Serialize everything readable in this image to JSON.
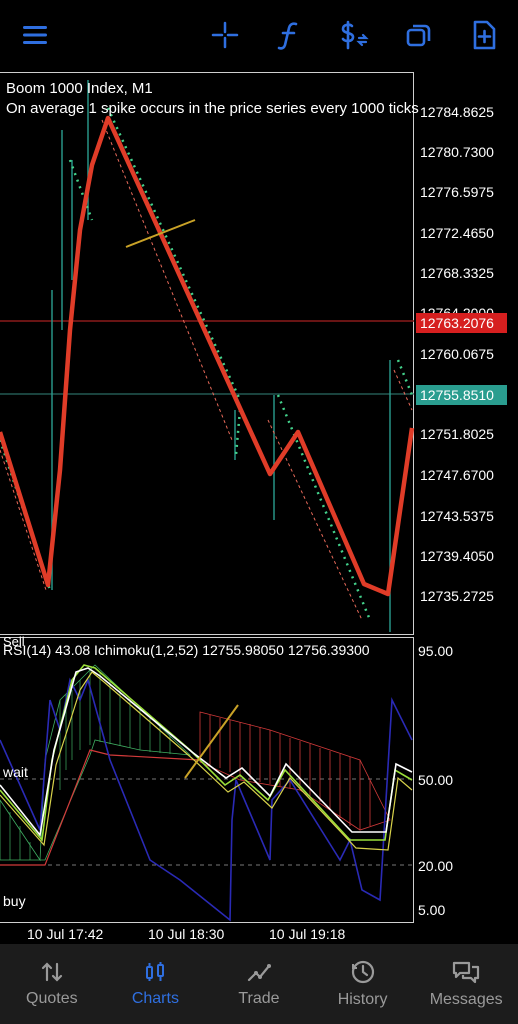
{
  "topbar": {
    "icons": [
      "menu-icon",
      "crosshair-icon",
      "function-icon",
      "trade-dollar-icon",
      "window-icon",
      "new-document-icon"
    ]
  },
  "chart": {
    "title": "Boom 1000 Index, M1",
    "subtitle": "On average 1 spike occurs in the price series every 1000 ticks",
    "price_scale": [
      "12784.8625",
      "12780.7300",
      "12776.5975",
      "12772.4650",
      "12768.3325",
      "12764.2000",
      "12760.0675",
      "12751.8025",
      "12747.6700",
      "12743.5375",
      "12739.4050",
      "12735.2725"
    ],
    "sell_line_price": "12763.2076",
    "bid_line_price": "12755.8510",
    "colors": {
      "sell_line": "#e02020",
      "bid_line": "#2a9d8f",
      "ma_line": "#e03c28",
      "dots": "#43d18b",
      "candle": "#2a9d8f",
      "trendline": "#c9a227"
    }
  },
  "oscillator": {
    "header": "RSI(14) 43.08 Ichimoku(1,2,52) 12755.98050 12756.39300",
    "sell_label": "Sell",
    "wait_label": "wait",
    "buy_label": "buy",
    "levels": [
      "95.00",
      "50.00",
      "20.00",
      "5.00"
    ]
  },
  "time_axis": [
    "10 Jul 17:42",
    "10 Jul 18:30",
    "10 Jul 19:18"
  ],
  "nav": {
    "items": [
      {
        "label": "Quotes",
        "icon": "quotes-icon"
      },
      {
        "label": "Charts",
        "icon": "charts-icon"
      },
      {
        "label": "Trade",
        "icon": "trade-icon"
      },
      {
        "label": "History",
        "icon": "history-icon"
      },
      {
        "label": "Messages",
        "icon": "messages-icon"
      }
    ],
    "active": "Charts"
  }
}
